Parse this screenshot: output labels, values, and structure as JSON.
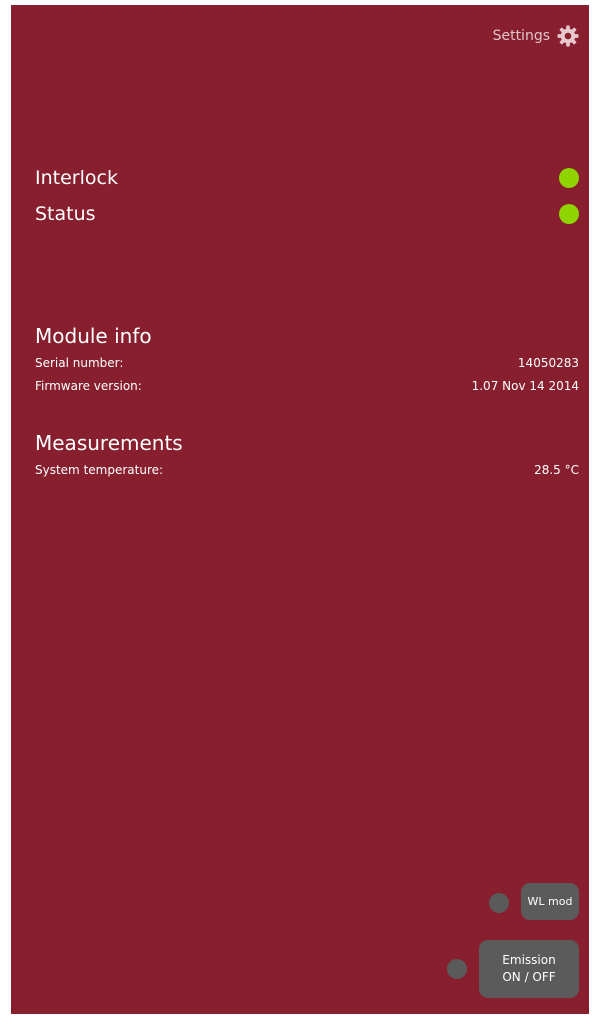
{
  "header": {
    "settings_label": "Settings",
    "settings_icon": "gear-icon"
  },
  "status_rows": [
    {
      "label": "Interlock",
      "state": "on",
      "color": "#8fd400"
    },
    {
      "label": "Status",
      "state": "on",
      "color": "#8fd400"
    }
  ],
  "module_info": {
    "title": "Module info",
    "items": [
      {
        "label": "Serial number:",
        "value": "14050283"
      },
      {
        "label": "Firmware version:",
        "value": "1.07 Nov 14 2014"
      }
    ]
  },
  "measurements": {
    "title": "Measurements",
    "items": [
      {
        "label": "System temperature:",
        "value": "28.5 °C"
      }
    ]
  },
  "controls": {
    "wl_mod": {
      "label": "WL mod",
      "indicator_color": "#5a5a5a"
    },
    "emission": {
      "line1": "Emission",
      "line2": "ON / OFF",
      "indicator_color": "#5a5a5a"
    }
  },
  "colors": {
    "background": "#871f2e",
    "led_on": "#8fd400",
    "button": "#5b5b5b"
  }
}
